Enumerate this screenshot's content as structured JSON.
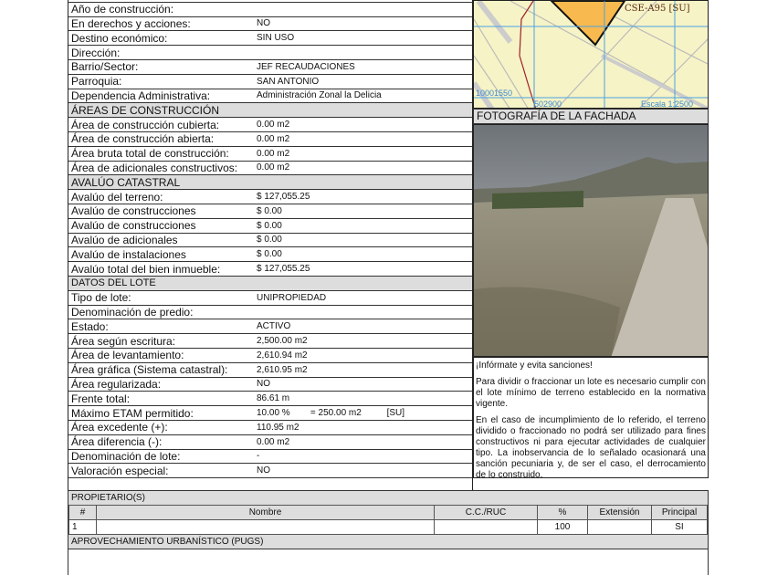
{
  "top_rows": [
    {
      "label": "",
      "value": ""
    },
    {
      "label": "Año de construcción:",
      "value": ""
    },
    {
      "label": "En derechos y acciones:",
      "value": "NO"
    },
    {
      "label": "Destino económico:",
      "value": "SIN USO"
    },
    {
      "label": "Dirección:",
      "value": ""
    },
    {
      "label": "Barrio/Sector:",
      "value": "JEF RECAUDACIONES"
    },
    {
      "label": "Parroquia:",
      "value": "SAN ANTONIO"
    },
    {
      "label": "Dependencia Administrativa:",
      "value": "Administración Zonal la Delicia"
    },
    {
      "header": "ÁREAS DE CONSTRUCCIÓN"
    },
    {
      "label": "Área de construcción cubierta:",
      "value": "0.00 m2"
    },
    {
      "label": "Área de construcción abierta:",
      "value": "0.00 m2"
    },
    {
      "label": "Área bruta total de construcción:",
      "value": "0.00 m2"
    },
    {
      "label": "Área de adicionales constructivos:",
      "value": "0.00 m2"
    },
    {
      "header": "AVALÚO CATASTRAL"
    },
    {
      "label": "Avalúo del terreno:",
      "value": "$ 127,055.25"
    },
    {
      "label": "Avalúo de construcciones",
      "value": "$ 0.00"
    },
    {
      "label": "Avalúo de construcciones",
      "value": "$ 0.00"
    },
    {
      "label": "Avalúo de adicionales",
      "value": "$ 0.00"
    },
    {
      "label": "Avalúo de instalaciones",
      "value": "$ 0.00"
    },
    {
      "label": "Avalúo total del bien inmueble:",
      "value": "$ 127,055.25"
    },
    {
      "header": "DATOS DEL LOTE",
      "small": true
    },
    {
      "label": "Tipo de lote:",
      "value": "UNIPROPIEDAD"
    },
    {
      "label": "Denominación de predio:",
      "value": ""
    },
    {
      "label": "Estado:",
      "value": "ACTIVO"
    },
    {
      "label": "Área según escritura:",
      "value": "2,500.00 m2"
    },
    {
      "label": "Área de levantamiento:",
      "value": "2,610.94 m2"
    },
    {
      "label": "Área gráfica (Sistema catastral):",
      "value": "2,610.95 m2"
    },
    {
      "label": "Área regularizada:",
      "value": "NO"
    },
    {
      "label": "Frente total:",
      "value": "86.61 m"
    },
    {
      "label": "Máximo ETAM permitido:",
      "value": "10.00 %        = 250.00 m2          [SU]"
    },
    {
      "label": "Área excedente (+):",
      "value": "110.95 m2"
    },
    {
      "label": "Área diferencia (-):",
      "value": "0.00 m2"
    },
    {
      "label": "Denominación de lote:",
      "value": "-"
    },
    {
      "label": "Valoración especial:",
      "value": "NO"
    }
  ],
  "map": {
    "zone_label": "CSE-A95 [SU]",
    "coord_y": "10001550",
    "coord_x": "502900",
    "scale": "Escala 1:2500",
    "parcel_color": "#f8b94f"
  },
  "facade": {
    "title": "FOTOGRAFÍA DE LA FACHADA"
  },
  "info": {
    "title": "¡Infórmate y evita sanciones!",
    "p1": "Para dividir o fraccionar un lote es necesario cumplir con el lote mínimo de terreno establecido en la normativa vigente.",
    "p2": "En el caso de incumplimiento de lo referido, el terreno dividido o fraccionado no podrá ser utilizado para fines constructivos ni para ejecutar actividades de cualquier tipo. La inobservancia de lo señalado ocasionará una sanción pecuniaria y, de ser el caso, el derrocamiento de lo construido."
  },
  "owners": {
    "title": "PROPIETARIO(S)",
    "headers": [
      "#",
      "Nombre",
      "C.C./RUC",
      "%",
      "Extensión",
      "Principal"
    ],
    "rows": [
      [
        "1",
        "",
        "",
        "100",
        "",
        "SI"
      ]
    ]
  },
  "pugs": {
    "title": "APROVECHAMIENTO URBANÍSTICO (PUGS)"
  }
}
